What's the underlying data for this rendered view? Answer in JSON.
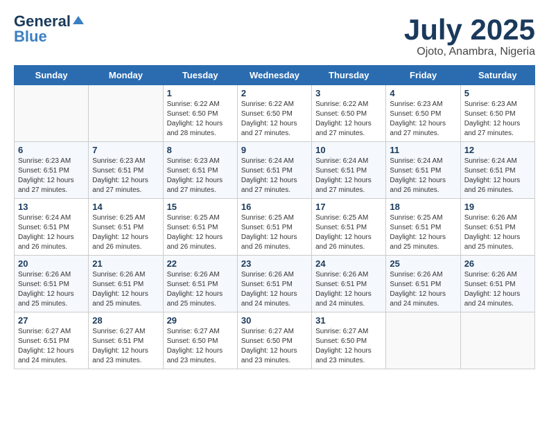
{
  "header": {
    "logo_general": "General",
    "logo_blue": "Blue",
    "month_title": "July 2025",
    "location": "Ojoto, Anambra, Nigeria"
  },
  "columns": [
    "Sunday",
    "Monday",
    "Tuesday",
    "Wednesday",
    "Thursday",
    "Friday",
    "Saturday"
  ],
  "weeks": [
    [
      {
        "day": "",
        "info": ""
      },
      {
        "day": "",
        "info": ""
      },
      {
        "day": "1",
        "info": "Sunrise: 6:22 AM\nSunset: 6:50 PM\nDaylight: 12 hours and 28 minutes."
      },
      {
        "day": "2",
        "info": "Sunrise: 6:22 AM\nSunset: 6:50 PM\nDaylight: 12 hours and 27 minutes."
      },
      {
        "day": "3",
        "info": "Sunrise: 6:22 AM\nSunset: 6:50 PM\nDaylight: 12 hours and 27 minutes."
      },
      {
        "day": "4",
        "info": "Sunrise: 6:23 AM\nSunset: 6:50 PM\nDaylight: 12 hours and 27 minutes."
      },
      {
        "day": "5",
        "info": "Sunrise: 6:23 AM\nSunset: 6:50 PM\nDaylight: 12 hours and 27 minutes."
      }
    ],
    [
      {
        "day": "6",
        "info": "Sunrise: 6:23 AM\nSunset: 6:51 PM\nDaylight: 12 hours and 27 minutes."
      },
      {
        "day": "7",
        "info": "Sunrise: 6:23 AM\nSunset: 6:51 PM\nDaylight: 12 hours and 27 minutes."
      },
      {
        "day": "8",
        "info": "Sunrise: 6:23 AM\nSunset: 6:51 PM\nDaylight: 12 hours and 27 minutes."
      },
      {
        "day": "9",
        "info": "Sunrise: 6:24 AM\nSunset: 6:51 PM\nDaylight: 12 hours and 27 minutes."
      },
      {
        "day": "10",
        "info": "Sunrise: 6:24 AM\nSunset: 6:51 PM\nDaylight: 12 hours and 27 minutes."
      },
      {
        "day": "11",
        "info": "Sunrise: 6:24 AM\nSunset: 6:51 PM\nDaylight: 12 hours and 26 minutes."
      },
      {
        "day": "12",
        "info": "Sunrise: 6:24 AM\nSunset: 6:51 PM\nDaylight: 12 hours and 26 minutes."
      }
    ],
    [
      {
        "day": "13",
        "info": "Sunrise: 6:24 AM\nSunset: 6:51 PM\nDaylight: 12 hours and 26 minutes."
      },
      {
        "day": "14",
        "info": "Sunrise: 6:25 AM\nSunset: 6:51 PM\nDaylight: 12 hours and 26 minutes."
      },
      {
        "day": "15",
        "info": "Sunrise: 6:25 AM\nSunset: 6:51 PM\nDaylight: 12 hours and 26 minutes."
      },
      {
        "day": "16",
        "info": "Sunrise: 6:25 AM\nSunset: 6:51 PM\nDaylight: 12 hours and 26 minutes."
      },
      {
        "day": "17",
        "info": "Sunrise: 6:25 AM\nSunset: 6:51 PM\nDaylight: 12 hours and 26 minutes."
      },
      {
        "day": "18",
        "info": "Sunrise: 6:25 AM\nSunset: 6:51 PM\nDaylight: 12 hours and 25 minutes."
      },
      {
        "day": "19",
        "info": "Sunrise: 6:26 AM\nSunset: 6:51 PM\nDaylight: 12 hours and 25 minutes."
      }
    ],
    [
      {
        "day": "20",
        "info": "Sunrise: 6:26 AM\nSunset: 6:51 PM\nDaylight: 12 hours and 25 minutes."
      },
      {
        "day": "21",
        "info": "Sunrise: 6:26 AM\nSunset: 6:51 PM\nDaylight: 12 hours and 25 minutes."
      },
      {
        "day": "22",
        "info": "Sunrise: 6:26 AM\nSunset: 6:51 PM\nDaylight: 12 hours and 25 minutes."
      },
      {
        "day": "23",
        "info": "Sunrise: 6:26 AM\nSunset: 6:51 PM\nDaylight: 12 hours and 24 minutes."
      },
      {
        "day": "24",
        "info": "Sunrise: 6:26 AM\nSunset: 6:51 PM\nDaylight: 12 hours and 24 minutes."
      },
      {
        "day": "25",
        "info": "Sunrise: 6:26 AM\nSunset: 6:51 PM\nDaylight: 12 hours and 24 minutes."
      },
      {
        "day": "26",
        "info": "Sunrise: 6:26 AM\nSunset: 6:51 PM\nDaylight: 12 hours and 24 minutes."
      }
    ],
    [
      {
        "day": "27",
        "info": "Sunrise: 6:27 AM\nSunset: 6:51 PM\nDaylight: 12 hours and 24 minutes."
      },
      {
        "day": "28",
        "info": "Sunrise: 6:27 AM\nSunset: 6:51 PM\nDaylight: 12 hours and 23 minutes."
      },
      {
        "day": "29",
        "info": "Sunrise: 6:27 AM\nSunset: 6:50 PM\nDaylight: 12 hours and 23 minutes."
      },
      {
        "day": "30",
        "info": "Sunrise: 6:27 AM\nSunset: 6:50 PM\nDaylight: 12 hours and 23 minutes."
      },
      {
        "day": "31",
        "info": "Sunrise: 6:27 AM\nSunset: 6:50 PM\nDaylight: 12 hours and 23 minutes."
      },
      {
        "day": "",
        "info": ""
      },
      {
        "day": "",
        "info": ""
      }
    ]
  ]
}
